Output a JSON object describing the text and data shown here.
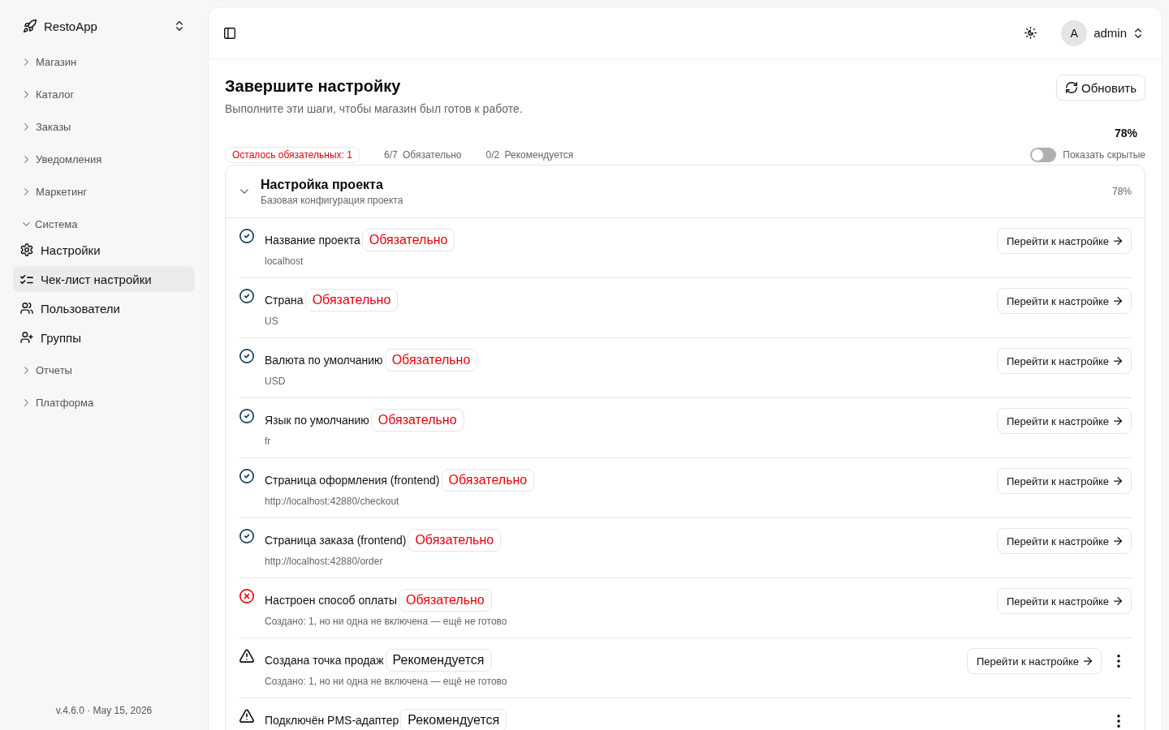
{
  "sidebar": {
    "brand": "RestoApp",
    "items": [
      {
        "label": "Магазин",
        "expanded": false
      },
      {
        "label": "Каталог",
        "expanded": false
      },
      {
        "label": "Заказы",
        "expanded": false
      },
      {
        "label": "Уведомления",
        "expanded": false
      },
      {
        "label": "Маркетинг",
        "expanded": false
      },
      {
        "label": "Система",
        "expanded": true,
        "children": [
          {
            "label": "Настройки",
            "selected": false
          },
          {
            "label": "Чек-лист настройки",
            "selected": true
          },
          {
            "label": "Пользователи",
            "selected": false
          },
          {
            "label": "Группы",
            "selected": false
          }
        ]
      },
      {
        "label": "Отчеты",
        "expanded": false
      },
      {
        "label": "Платформа",
        "expanded": false
      }
    ],
    "version": "v.4.6.0 · May 15, 2026"
  },
  "topbar": {
    "user": {
      "avatar_initial": "A",
      "name": "admin"
    }
  },
  "page": {
    "title": "Завершите настройку",
    "subtitle": "Выполните эти шаги, чтобы магазин был готов к работе.",
    "refresh_button": "Обновить",
    "progress_percent": "78%",
    "remaining_badge": "Осталось обязательных: 1",
    "stats": [
      {
        "count": "6/7",
        "label": "Обязательно"
      },
      {
        "count": "0/2",
        "label": "Рекомендуется"
      }
    ],
    "show_hidden": {
      "label": "Показать скрытые",
      "on": false
    }
  },
  "section": {
    "title": "Настройка проекта",
    "subtitle": "Базовая конфигурация проекта",
    "percent": "78%",
    "expanded": true,
    "items": [
      {
        "completed": true,
        "required": true,
        "title": "Название проекта",
        "badge": "Обязательно",
        "detail": "localhost",
        "action": "Перейти к настройке",
        "menu": false
      },
      {
        "completed": true,
        "required": true,
        "title": "Страна",
        "badge": "Обязательно",
        "detail": "US",
        "action": "Перейти к настройке",
        "menu": false
      },
      {
        "completed": true,
        "required": true,
        "title": "Валюта по умолчанию",
        "badge": "Обязательно",
        "detail": "USD",
        "action": "Перейти к настройке",
        "menu": false
      },
      {
        "completed": true,
        "required": true,
        "title": "Язык по умолчанию",
        "badge": "Обязательно",
        "detail": "fr",
        "action": "Перейти к настройке",
        "menu": false
      },
      {
        "completed": true,
        "required": true,
        "title": "Страница оформления (frontend)",
        "badge": "Обязательно",
        "detail": "http://localhost:42880/checkout",
        "action": "Перейти к настройке",
        "menu": false
      },
      {
        "completed": true,
        "required": true,
        "title": "Страница заказа (frontend)",
        "badge": "Обязательно",
        "detail": "http://localhost:42880/order",
        "action": "Перейти к настройке",
        "menu": false
      },
      {
        "completed": false,
        "required": true,
        "title": "Настроен способ оплаты",
        "badge": "Обязательно",
        "detail": "Создано: 1, но ни одна не включена — ещё не готово",
        "action": "Перейти к настройке",
        "menu": false
      },
      {
        "completed": false,
        "required": false,
        "title": "Создана точка продаж",
        "badge": "Рекомендуется",
        "detail": "Создано: 1, но ни одна не включена — ещё не готово",
        "action": "Перейти к настройке",
        "menu": true
      },
      {
        "completed": false,
        "required": false,
        "title": "Подключён PMS-адаптер",
        "badge": "Рекомендуется",
        "menu": true
      }
    ]
  }
}
